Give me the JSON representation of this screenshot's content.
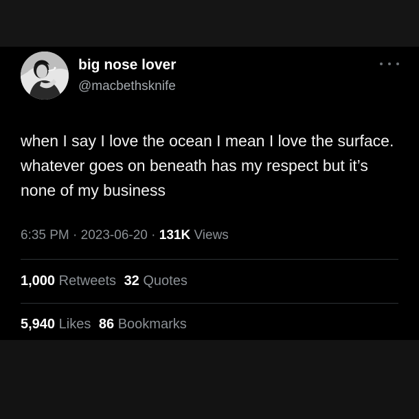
{
  "tweet": {
    "display_name": "big nose lover",
    "handle": "@macbethsknife",
    "avatar_icon": "profile-photo",
    "more_icon": "more-options-icon",
    "text": "when I say I love the ocean I mean I love the surface. whatever goes on beneath has my respect but it’s none of my business",
    "time": "6:35 PM",
    "separator": "·",
    "date": "2023-06-20",
    "views_count": "131K",
    "views_label": "Views"
  },
  "stats": {
    "retweets_count": "1,000",
    "retweets_label": "Retweets",
    "quotes_count": "32",
    "quotes_label": "Quotes",
    "likes_count": "5,940",
    "likes_label": "Likes",
    "bookmarks_count": "86",
    "bookmarks_label": "Bookmarks"
  },
  "colors": {
    "tweet_background": "#000000",
    "outer_background": "#141414",
    "primary_text": "#ffffff",
    "secondary_text": "#8b9095",
    "divider": "#2f3336"
  }
}
